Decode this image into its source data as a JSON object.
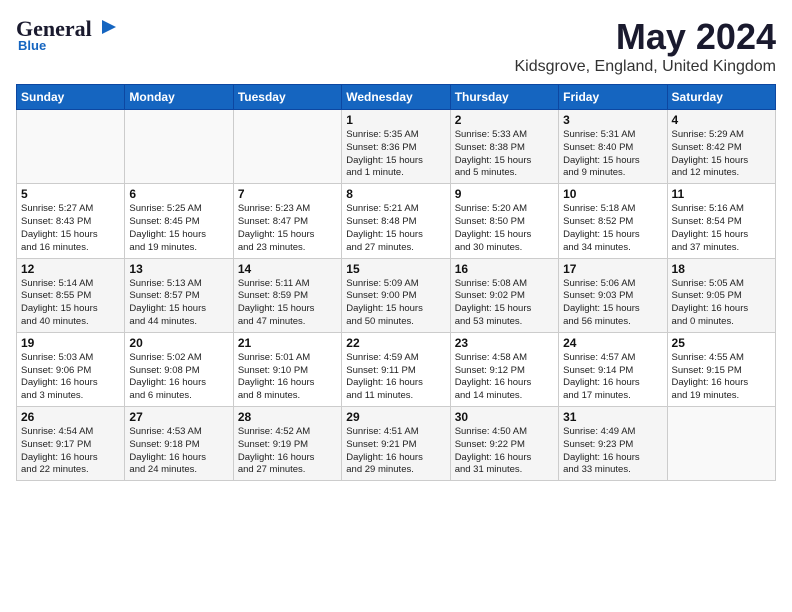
{
  "header": {
    "logo_general": "General",
    "logo_blue": "Blue",
    "title": "May 2024",
    "subtitle": "Kidsgrove, England, United Kingdom"
  },
  "calendar": {
    "days_of_week": [
      "Sunday",
      "Monday",
      "Tuesday",
      "Wednesday",
      "Thursday",
      "Friday",
      "Saturday"
    ],
    "weeks": [
      [
        {
          "day": "",
          "info": ""
        },
        {
          "day": "",
          "info": ""
        },
        {
          "day": "",
          "info": ""
        },
        {
          "day": "1",
          "info": "Sunrise: 5:35 AM\nSunset: 8:36 PM\nDaylight: 15 hours\nand 1 minute."
        },
        {
          "day": "2",
          "info": "Sunrise: 5:33 AM\nSunset: 8:38 PM\nDaylight: 15 hours\nand 5 minutes."
        },
        {
          "day": "3",
          "info": "Sunrise: 5:31 AM\nSunset: 8:40 PM\nDaylight: 15 hours\nand 9 minutes."
        },
        {
          "day": "4",
          "info": "Sunrise: 5:29 AM\nSunset: 8:42 PM\nDaylight: 15 hours\nand 12 minutes."
        }
      ],
      [
        {
          "day": "5",
          "info": "Sunrise: 5:27 AM\nSunset: 8:43 PM\nDaylight: 15 hours\nand 16 minutes."
        },
        {
          "day": "6",
          "info": "Sunrise: 5:25 AM\nSunset: 8:45 PM\nDaylight: 15 hours\nand 19 minutes."
        },
        {
          "day": "7",
          "info": "Sunrise: 5:23 AM\nSunset: 8:47 PM\nDaylight: 15 hours\nand 23 minutes."
        },
        {
          "day": "8",
          "info": "Sunrise: 5:21 AM\nSunset: 8:48 PM\nDaylight: 15 hours\nand 27 minutes."
        },
        {
          "day": "9",
          "info": "Sunrise: 5:20 AM\nSunset: 8:50 PM\nDaylight: 15 hours\nand 30 minutes."
        },
        {
          "day": "10",
          "info": "Sunrise: 5:18 AM\nSunset: 8:52 PM\nDaylight: 15 hours\nand 34 minutes."
        },
        {
          "day": "11",
          "info": "Sunrise: 5:16 AM\nSunset: 8:54 PM\nDaylight: 15 hours\nand 37 minutes."
        }
      ],
      [
        {
          "day": "12",
          "info": "Sunrise: 5:14 AM\nSunset: 8:55 PM\nDaylight: 15 hours\nand 40 minutes."
        },
        {
          "day": "13",
          "info": "Sunrise: 5:13 AM\nSunset: 8:57 PM\nDaylight: 15 hours\nand 44 minutes."
        },
        {
          "day": "14",
          "info": "Sunrise: 5:11 AM\nSunset: 8:59 PM\nDaylight: 15 hours\nand 47 minutes."
        },
        {
          "day": "15",
          "info": "Sunrise: 5:09 AM\nSunset: 9:00 PM\nDaylight: 15 hours\nand 50 minutes."
        },
        {
          "day": "16",
          "info": "Sunrise: 5:08 AM\nSunset: 9:02 PM\nDaylight: 15 hours\nand 53 minutes."
        },
        {
          "day": "17",
          "info": "Sunrise: 5:06 AM\nSunset: 9:03 PM\nDaylight: 15 hours\nand 56 minutes."
        },
        {
          "day": "18",
          "info": "Sunrise: 5:05 AM\nSunset: 9:05 PM\nDaylight: 16 hours\nand 0 minutes."
        }
      ],
      [
        {
          "day": "19",
          "info": "Sunrise: 5:03 AM\nSunset: 9:06 PM\nDaylight: 16 hours\nand 3 minutes."
        },
        {
          "day": "20",
          "info": "Sunrise: 5:02 AM\nSunset: 9:08 PM\nDaylight: 16 hours\nand 6 minutes."
        },
        {
          "day": "21",
          "info": "Sunrise: 5:01 AM\nSunset: 9:10 PM\nDaylight: 16 hours\nand 8 minutes."
        },
        {
          "day": "22",
          "info": "Sunrise: 4:59 AM\nSunset: 9:11 PM\nDaylight: 16 hours\nand 11 minutes."
        },
        {
          "day": "23",
          "info": "Sunrise: 4:58 AM\nSunset: 9:12 PM\nDaylight: 16 hours\nand 14 minutes."
        },
        {
          "day": "24",
          "info": "Sunrise: 4:57 AM\nSunset: 9:14 PM\nDaylight: 16 hours\nand 17 minutes."
        },
        {
          "day": "25",
          "info": "Sunrise: 4:55 AM\nSunset: 9:15 PM\nDaylight: 16 hours\nand 19 minutes."
        }
      ],
      [
        {
          "day": "26",
          "info": "Sunrise: 4:54 AM\nSunset: 9:17 PM\nDaylight: 16 hours\nand 22 minutes."
        },
        {
          "day": "27",
          "info": "Sunrise: 4:53 AM\nSunset: 9:18 PM\nDaylight: 16 hours\nand 24 minutes."
        },
        {
          "day": "28",
          "info": "Sunrise: 4:52 AM\nSunset: 9:19 PM\nDaylight: 16 hours\nand 27 minutes."
        },
        {
          "day": "29",
          "info": "Sunrise: 4:51 AM\nSunset: 9:21 PM\nDaylight: 16 hours\nand 29 minutes."
        },
        {
          "day": "30",
          "info": "Sunrise: 4:50 AM\nSunset: 9:22 PM\nDaylight: 16 hours\nand 31 minutes."
        },
        {
          "day": "31",
          "info": "Sunrise: 4:49 AM\nSunset: 9:23 PM\nDaylight: 16 hours\nand 33 minutes."
        },
        {
          "day": "",
          "info": ""
        }
      ]
    ]
  }
}
